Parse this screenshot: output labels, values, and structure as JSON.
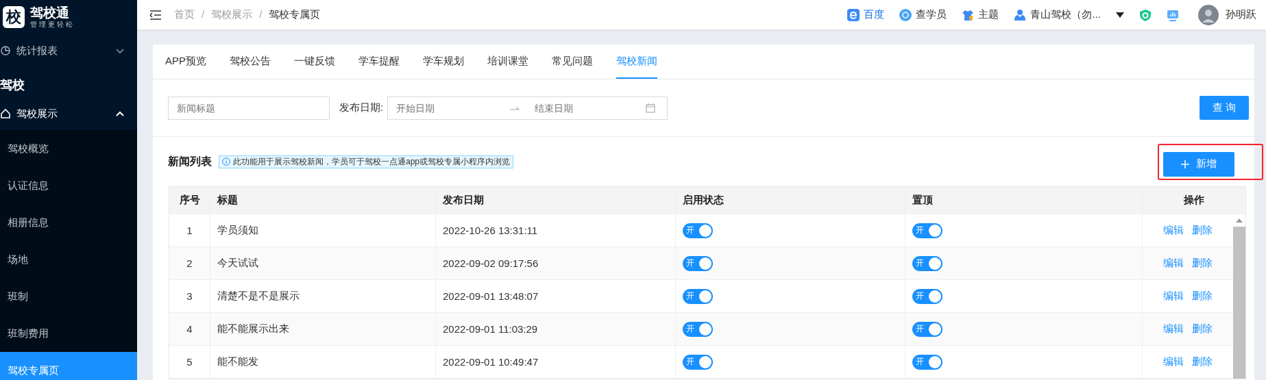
{
  "sidebar": {
    "logo": {
      "mark": "校",
      "title": "驾校通",
      "subtitle": "管理更轻松"
    },
    "items": [
      {
        "kind": "group",
        "label": "统计报表",
        "expanded": false
      },
      {
        "kind": "section",
        "label": "驾校"
      },
      {
        "kind": "group",
        "label": "驾校展示",
        "expanded": true,
        "children": [
          {
            "label": "驾校概览",
            "selected": false
          },
          {
            "label": "认证信息",
            "selected": false
          },
          {
            "label": "相册信息",
            "selected": false
          },
          {
            "label": "场地",
            "selected": false
          },
          {
            "label": "班制",
            "selected": false
          },
          {
            "label": "班制费用",
            "selected": false
          },
          {
            "label": "驾校专属页",
            "selected": true
          }
        ]
      }
    ]
  },
  "header": {
    "breadcrumb": [
      "首页",
      "驾校展示",
      "驾校专属页"
    ],
    "breadcrumb_separator": "/",
    "links": [
      {
        "kind": "baidu",
        "label": "百度"
      },
      {
        "kind": "search",
        "label": "查学员"
      },
      {
        "kind": "theme",
        "label": "主题"
      },
      {
        "kind": "school",
        "label": "青山驾校（勿...",
        "dropdown": true
      },
      {
        "kind": "shield"
      },
      {
        "kind": "monitor"
      }
    ],
    "user": "孙明跃"
  },
  "tabs": [
    {
      "label": "APP预览",
      "selected": false
    },
    {
      "label": "驾校公告",
      "selected": false
    },
    {
      "label": "一键反馈",
      "selected": false
    },
    {
      "label": "学车提醒",
      "selected": false
    },
    {
      "label": "学车规划",
      "selected": false
    },
    {
      "label": "培训课堂",
      "selected": false
    },
    {
      "label": "常见问题",
      "selected": false
    },
    {
      "label": "驾校新闻",
      "selected": true
    }
  ],
  "filters": {
    "title_field": {
      "placeholder": "新闻标题"
    },
    "date_label": "发布日期:",
    "date_start": {
      "placeholder": "开始日期"
    },
    "date_end": {
      "placeholder": "结束日期"
    },
    "query_button": "查 询"
  },
  "list": {
    "title": "新闻列表",
    "notice": "此功能用于展示驾校新闻，学员可于驾校一点通app或驾校专属小程序内浏览",
    "add_button": {
      "label": "新增",
      "highlighted": true
    }
  },
  "table": {
    "columns": [
      "序号",
      "标题",
      "发布日期",
      "启用状态",
      "置顶",
      "操作"
    ],
    "rows": [
      {
        "index": "1",
        "title": "学员须知",
        "date": "2022-10-26 13:31:11",
        "enabled": {
          "on": true,
          "label": "开"
        },
        "pinned": {
          "on": true,
          "label": "开"
        },
        "actions": [
          "编辑",
          "删除"
        ]
      },
      {
        "index": "2",
        "title": "今天试试",
        "date": "2022-09-02 09:17:56",
        "enabled": {
          "on": true,
          "label": "开"
        },
        "pinned": {
          "on": true,
          "label": "开"
        },
        "actions": [
          "编辑",
          "删除"
        ]
      },
      {
        "index": "3",
        "title": "清楚不是不是展示",
        "date": "2022-09-01 13:48:07",
        "enabled": {
          "on": true,
          "label": "开"
        },
        "pinned": {
          "on": true,
          "label": "开"
        },
        "actions": [
          "编辑",
          "删除"
        ]
      },
      {
        "index": "4",
        "title": "能不能展示出来",
        "date": "2022-09-01 11:03:29",
        "enabled": {
          "on": true,
          "label": "开"
        },
        "pinned": {
          "on": true,
          "label": "开"
        },
        "actions": [
          "编辑",
          "删除"
        ]
      },
      {
        "index": "5",
        "title": "能不能发",
        "date": "2022-09-01 10:49:47",
        "enabled": {
          "on": true,
          "label": "开"
        },
        "pinned": {
          "on": true,
          "label": "开"
        },
        "actions": [
          "编辑",
          "删除"
        ]
      }
    ]
  }
}
